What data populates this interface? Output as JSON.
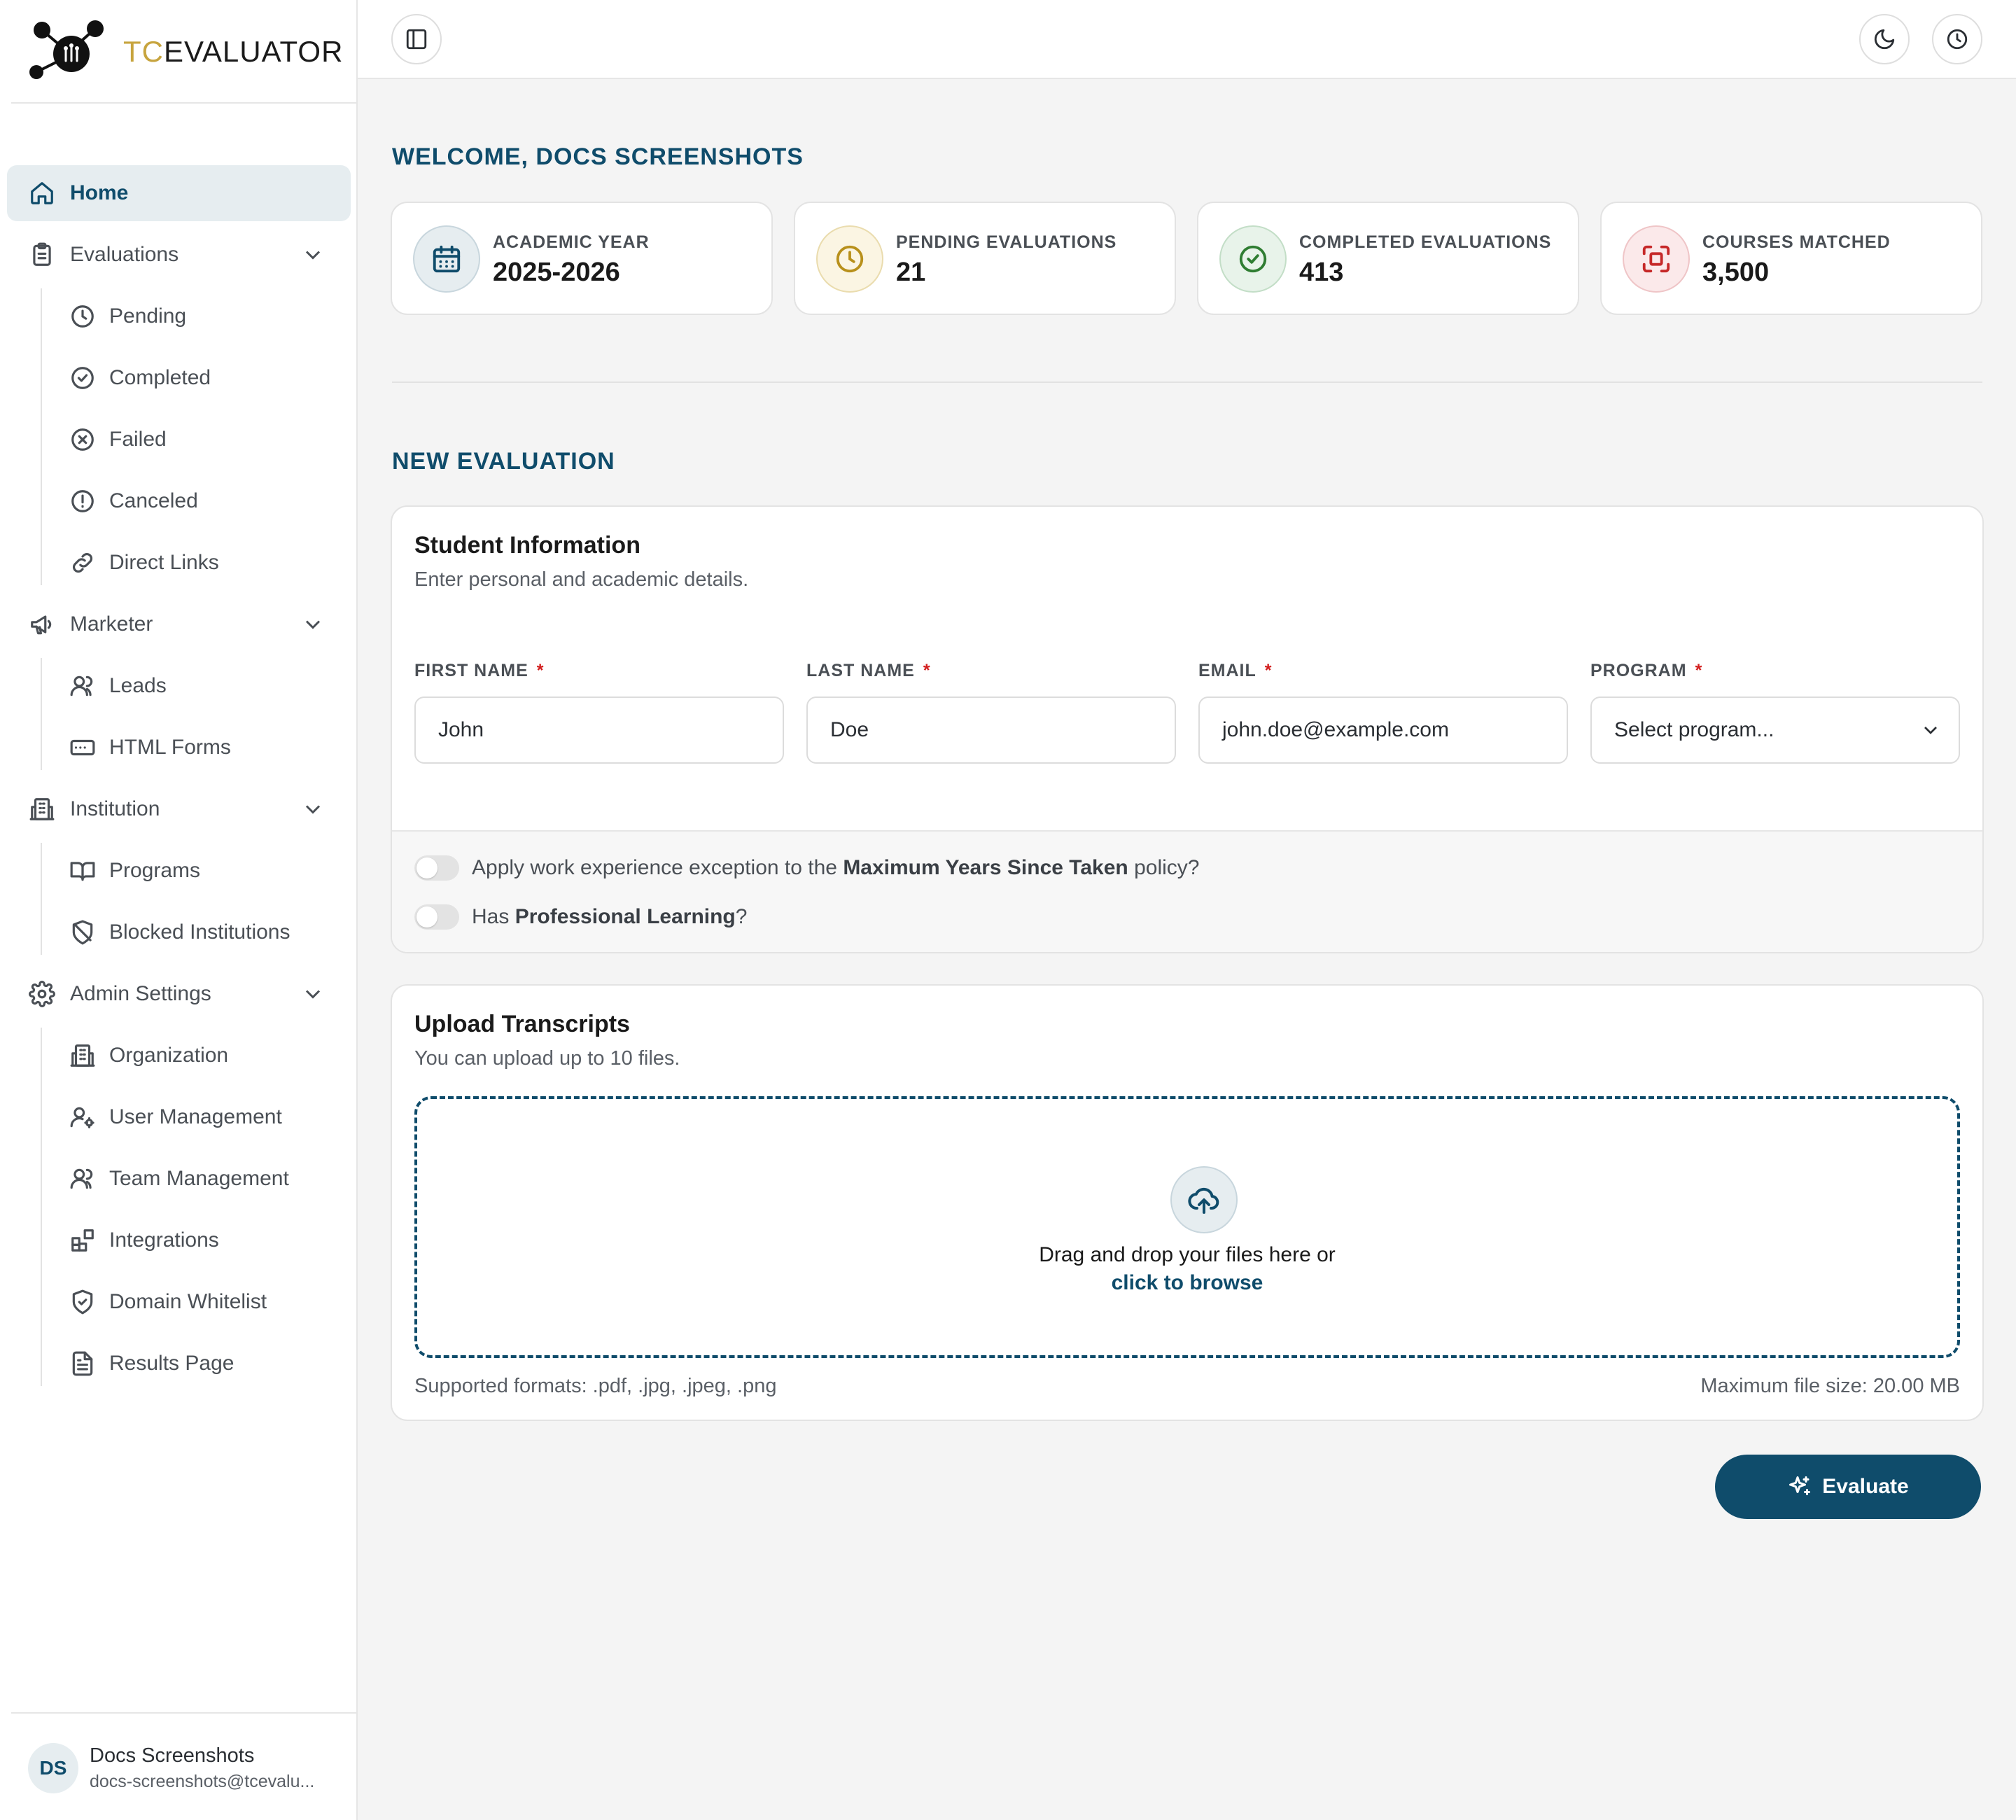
{
  "brand": {
    "name_part1": "TC",
    "name_part2": "EVALUATOR"
  },
  "sidebar": {
    "home": "Home",
    "evaluations": {
      "label": "Evaluations",
      "items": [
        "Pending",
        "Completed",
        "Failed",
        "Canceled",
        "Direct Links"
      ]
    },
    "marketer": {
      "label": "Marketer",
      "items": [
        "Leads",
        "HTML Forms"
      ]
    },
    "institution": {
      "label": "Institution",
      "items": [
        "Programs",
        "Blocked Institutions"
      ]
    },
    "admin": {
      "label": "Admin Settings",
      "items": [
        "Organization",
        "User Management",
        "Team Management",
        "Integrations",
        "Domain Whitelist",
        "Results Page"
      ]
    },
    "user": {
      "initials": "DS",
      "name": "Docs Screenshots",
      "email": "docs-screenshots@tcevalu..."
    }
  },
  "welcome": "WELCOME, DOCS SCREENSHOTS",
  "stats": [
    {
      "label": "ACADEMIC YEAR",
      "value": "2025-2026",
      "icon": "calendar-icon",
      "color": "#0f4c6b"
    },
    {
      "label": "PENDING EVALUATIONS",
      "value": "21",
      "icon": "clock-icon",
      "color": "#b8901b"
    },
    {
      "label": "COMPLETED EVALUATIONS",
      "value": "413",
      "icon": "check-circle-icon",
      "color": "#2f7d32"
    },
    {
      "label": "COURSES MATCHED",
      "value": "3,500",
      "icon": "scan-icon",
      "color": "#c62828"
    }
  ],
  "new_evaluation": "NEW EVALUATION",
  "student": {
    "title": "Student Information",
    "subtitle": "Enter personal and academic details.",
    "fields": [
      {
        "label": "FIRST NAME",
        "value": "John"
      },
      {
        "label": "LAST NAME",
        "value": "Doe"
      },
      {
        "label": "EMAIL",
        "value": "john.doe@example.com"
      },
      {
        "label": "PROGRAM",
        "value": "Select program..."
      }
    ],
    "required_mark": "*",
    "toggle1": {
      "before": "Apply work experience exception to the ",
      "bold": "Maximum Years Since Taken",
      "after": " policy?"
    },
    "toggle2": {
      "before": "Has ",
      "bold": "Professional Learning",
      "after": "?"
    }
  },
  "upload": {
    "title": "Upload Transcripts",
    "subtitle": "You can upload up to 10 files.",
    "drop_text": "Drag and drop your files here or",
    "browse_link": "click to browse",
    "formats": "Supported formats: .pdf, .jpg, .jpeg, .png",
    "max_size": "Maximum file size: 20.00 MB"
  },
  "evaluate_button": "Evaluate",
  "colors": {
    "accent": "#0f4c6b",
    "brand_gold": "#c7a43e",
    "required": "#d21c1c"
  }
}
